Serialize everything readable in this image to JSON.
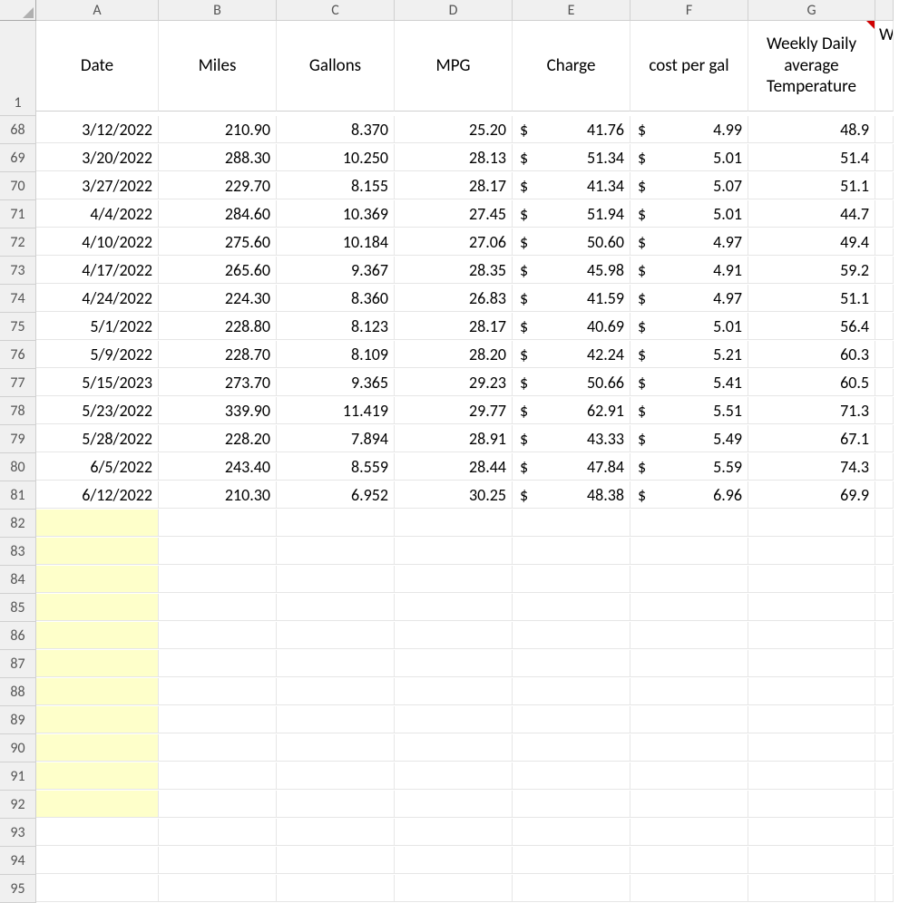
{
  "columns": [
    "A",
    "B",
    "C",
    "D",
    "E",
    "F",
    "G"
  ],
  "header_row_number": "1",
  "headers": {
    "A": "Date",
    "B": "Miles",
    "C": "Gallons",
    "D": "MPG",
    "E": "Charge",
    "F": "cost per gal",
    "G": "Weekly Daily average Temperature"
  },
  "row_numbers": [
    "68",
    "69",
    "70",
    "71",
    "72",
    "73",
    "74",
    "75",
    "76",
    "77",
    "78",
    "79",
    "80",
    "81",
    "82",
    "83",
    "84",
    "85",
    "86",
    "87",
    "88",
    "89",
    "90",
    "91",
    "92",
    "93",
    "94",
    "95"
  ],
  "rows": [
    {
      "date": "3/12/2022",
      "miles": "210.90",
      "gallons": "8.370",
      "mpg": "25.20",
      "charge": "41.76",
      "cpg": "4.99",
      "temp": "48.9"
    },
    {
      "date": "3/20/2022",
      "miles": "288.30",
      "gallons": "10.250",
      "mpg": "28.13",
      "charge": "51.34",
      "cpg": "5.01",
      "temp": "51.4"
    },
    {
      "date": "3/27/2022",
      "miles": "229.70",
      "gallons": "8.155",
      "mpg": "28.17",
      "charge": "41.34",
      "cpg": "5.07",
      "temp": "51.1"
    },
    {
      "date": "4/4/2022",
      "miles": "284.60",
      "gallons": "10.369",
      "mpg": "27.45",
      "charge": "51.94",
      "cpg": "5.01",
      "temp": "44.7"
    },
    {
      "date": "4/10/2022",
      "miles": "275.60",
      "gallons": "10.184",
      "mpg": "27.06",
      "charge": "50.60",
      "cpg": "4.97",
      "temp": "49.4"
    },
    {
      "date": "4/17/2022",
      "miles": "265.60",
      "gallons": "9.367",
      "mpg": "28.35",
      "charge": "45.98",
      "cpg": "4.91",
      "temp": "59.2"
    },
    {
      "date": "4/24/2022",
      "miles": "224.30",
      "gallons": "8.360",
      "mpg": "26.83",
      "charge": "41.59",
      "cpg": "4.97",
      "temp": "51.1"
    },
    {
      "date": "5/1/2022",
      "miles": "228.80",
      "gallons": "8.123",
      "mpg": "28.17",
      "charge": "40.69",
      "cpg": "5.01",
      "temp": "56.4"
    },
    {
      "date": "5/9/2022",
      "miles": "228.70",
      "gallons": "8.109",
      "mpg": "28.20",
      "charge": "42.24",
      "cpg": "5.21",
      "temp": "60.3"
    },
    {
      "date": "5/15/2023",
      "miles": "273.70",
      "gallons": "9.365",
      "mpg": "29.23",
      "charge": "50.66",
      "cpg": "5.41",
      "temp": "60.5"
    },
    {
      "date": "5/23/2022",
      "miles": "339.90",
      "gallons": "11.419",
      "mpg": "29.77",
      "charge": "62.91",
      "cpg": "5.51",
      "temp": "71.3"
    },
    {
      "date": "5/28/2022",
      "miles": "228.20",
      "gallons": "7.894",
      "mpg": "28.91",
      "charge": "43.33",
      "cpg": "5.49",
      "temp": "67.1"
    },
    {
      "date": "6/5/2022",
      "miles": "243.40",
      "gallons": "8.559",
      "mpg": "28.44",
      "charge": "47.84",
      "cpg": "5.59",
      "temp": "74.3"
    },
    {
      "date": "6/12/2022",
      "miles": "210.30",
      "gallons": "6.952",
      "mpg": "30.25",
      "charge": "48.38",
      "cpg": "6.96",
      "temp": "69.9"
    }
  ],
  "yellow_rows": [
    "82",
    "83",
    "84",
    "85",
    "86",
    "87",
    "88",
    "89",
    "90",
    "91",
    "92"
  ],
  "currency_symbol": "$",
  "partial_header_col": "W"
}
